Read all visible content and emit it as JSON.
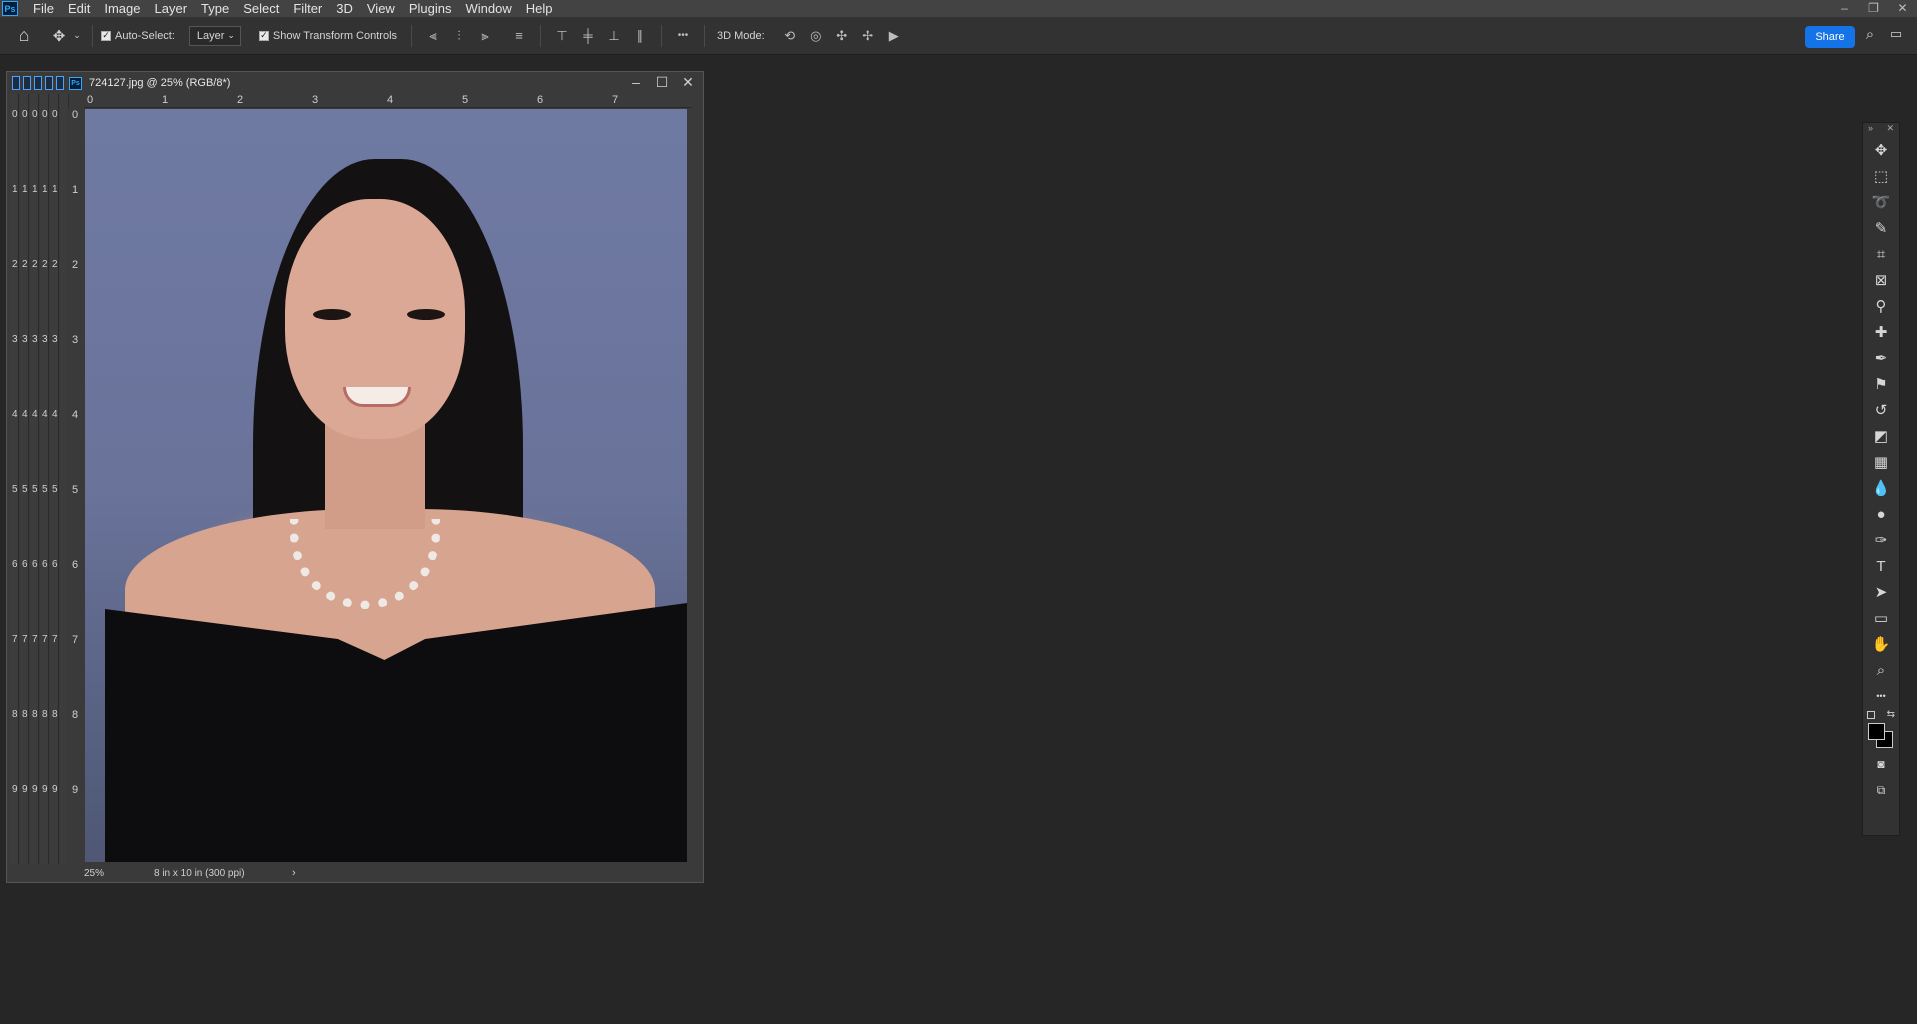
{
  "menubar": {
    "logo": "Ps",
    "items": [
      "File",
      "Edit",
      "Image",
      "Layer",
      "Type",
      "Select",
      "Filter",
      "3D",
      "View",
      "Plugins",
      "Window",
      "Help"
    ],
    "window_controls": [
      "–",
      "❐",
      "✕"
    ]
  },
  "options": {
    "auto_select_label": "Auto-Select:",
    "auto_select_target": "Layer",
    "show_transform_label": "Show Transform Controls",
    "mode_label": "3D Mode:",
    "share_label": "Share",
    "more_label": "•••"
  },
  "document": {
    "title": "724127.jpg @ 25% (RGB/8*)",
    "zoom": "25%",
    "size": "8 in x 10 in (300 ppi)",
    "tab_icon": "Ps",
    "ruler_h": [
      "0",
      "1",
      "2",
      "3",
      "4",
      "5",
      "6",
      "7"
    ],
    "ruler_v": [
      "0",
      "1",
      "2",
      "3",
      "4",
      "5",
      "6",
      "7",
      "8",
      "9"
    ],
    "strip_digits": [
      "0",
      "1",
      "2",
      "3",
      "4",
      "5",
      "6",
      "7",
      "8",
      "9"
    ],
    "controls": [
      "–",
      "☐",
      "✕"
    ]
  },
  "toolbar": {
    "tools": [
      "move-icon",
      "marquee-icon",
      "lasso-icon",
      "quick-select-icon",
      "crop-icon",
      "frame-icon",
      "eyedropper-icon",
      "healing-icon",
      "brush-icon",
      "stamp-icon",
      "history-brush-icon",
      "eraser-icon",
      "gradient-icon",
      "blur-icon",
      "dodge-icon",
      "pen-icon",
      "type-icon",
      "path-select-icon",
      "rectangle-icon",
      "hand-icon",
      "zoom-icon",
      "more-tools-icon"
    ]
  },
  "colors": {
    "foreground": "#000000",
    "background": "#000000",
    "accent": "#1473e6"
  }
}
